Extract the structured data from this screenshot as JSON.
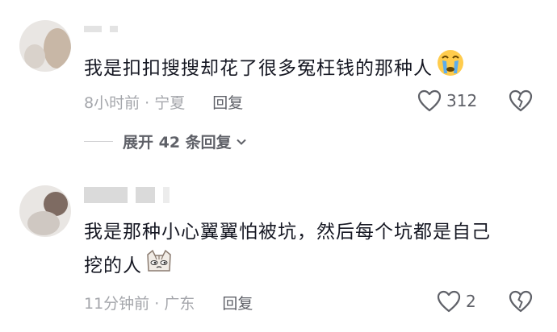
{
  "comments": [
    {
      "text": "我是扣扣搜搜却花了很多冤枉钱的那种人",
      "emoji": "crying-face-emoji",
      "time": "8小时前",
      "location": "宁夏",
      "reply_label": "回复",
      "likes": "312",
      "replies_expand": "展开 42 条回复"
    },
    {
      "text_line1": "我是那种小心翼翼怕被坑，然后每个坑都是自己",
      "text_line2": "挖的人",
      "emoji": "cat-face-emoji",
      "time": "11分钟前",
      "location": "广东",
      "reply_label": "回复",
      "likes": "2"
    }
  ],
  "separator": "·",
  "colors": {
    "text": "#161823",
    "meta": "#a4a6ab",
    "action": "#5f6168"
  }
}
